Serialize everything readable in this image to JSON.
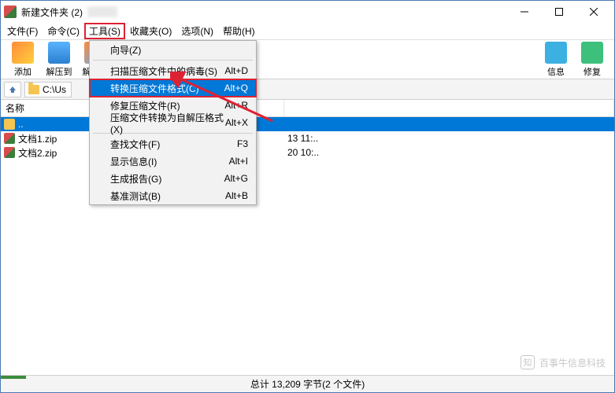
{
  "title": "新建文件夹 (2)",
  "menubar": [
    "文件(F)",
    "命令(C)",
    "工具(S)",
    "收藏夹(O)",
    "选项(N)",
    "帮助(H)"
  ],
  "menubar_active_index": 2,
  "toolbar": [
    {
      "label": "添加",
      "cls": "icon-add"
    },
    {
      "label": "解压到",
      "cls": "icon-extract1"
    },
    {
      "label": "解压到",
      "cls": "icon-extract2"
    },
    {
      "label": "",
      "cls": ""
    },
    {
      "label": "",
      "cls": ""
    },
    {
      "label": "",
      "cls": ""
    },
    {
      "label": "",
      "cls": ""
    },
    {
      "label": "信息",
      "cls": "icon-info"
    },
    {
      "label": "修复",
      "cls": "icon-repair"
    }
  ],
  "path": "C:\\Us",
  "columns": {
    "name": "名称",
    "size": "",
    "date": ""
  },
  "rows": [
    {
      "selected": true,
      "icon": "up",
      "name": "..",
      "size": "",
      "date": ""
    },
    {
      "selected": false,
      "icon": "file",
      "name": "文档1.zip",
      "size": "",
      "date": "13 11:.."
    },
    {
      "selected": false,
      "icon": "file",
      "name": "文档2.zip",
      "size": "",
      "date": "20 10:.."
    }
  ],
  "dropdown": [
    {
      "type": "item",
      "label": "向导(Z)",
      "shortcut": ""
    },
    {
      "type": "sep"
    },
    {
      "type": "item",
      "label": "扫描压缩文件中的病毒(S)",
      "shortcut": "Alt+D"
    },
    {
      "type": "item",
      "label": "转换压缩文件格式(C)",
      "shortcut": "Alt+Q",
      "highlight": true,
      "boxed": true
    },
    {
      "type": "item",
      "label": "修复压缩文件(R)",
      "shortcut": "Alt+R"
    },
    {
      "type": "item",
      "label": "压缩文件转换为自解压格式(X)",
      "shortcut": "Alt+X"
    },
    {
      "type": "sep"
    },
    {
      "type": "item",
      "label": "查找文件(F)",
      "shortcut": "F3"
    },
    {
      "type": "item",
      "label": "显示信息(I)",
      "shortcut": "Alt+I"
    },
    {
      "type": "item",
      "label": "生成报告(G)",
      "shortcut": "Alt+G"
    },
    {
      "type": "item",
      "label": "基准测试(B)",
      "shortcut": "Alt+B"
    }
  ],
  "status": "总计 13,209 字节(2 个文件)",
  "watermark": "百事牛信息科技"
}
